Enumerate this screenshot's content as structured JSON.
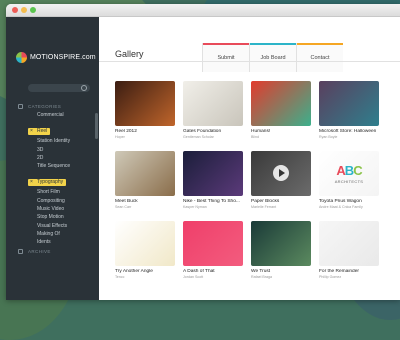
{
  "brand": {
    "name": "MOTIONSPIRE.com"
  },
  "sidebar": {
    "search_placeholder": "",
    "categories_title": "CATEGORIES",
    "archive_title": "ARCHIVE",
    "categories": [
      {
        "label": "Commercial",
        "selected": false
      },
      {
        "label": "Reel",
        "selected": true
      },
      {
        "label": "Station Identity",
        "selected": false
      },
      {
        "label": "3D",
        "selected": false
      },
      {
        "label": "2D",
        "selected": false
      },
      {
        "label": "Title Sequence",
        "selected": false
      },
      {
        "label": "Typography",
        "selected": true
      },
      {
        "label": "Short Film",
        "selected": false
      },
      {
        "label": "Compositing",
        "selected": false
      },
      {
        "label": "Music Video",
        "selected": false
      },
      {
        "label": "Stop Motion",
        "selected": false
      },
      {
        "label": "Visual Effects",
        "selected": false
      },
      {
        "label": "Making Of",
        "selected": false
      },
      {
        "label": "Idents",
        "selected": false
      }
    ]
  },
  "header": {
    "title": "Gallery",
    "nav": [
      {
        "label": "Submit",
        "accent": "#e84b5a"
      },
      {
        "label": "Job Board",
        "accent": "#2cb4c8"
      },
      {
        "label": "Contact",
        "accent": "#f5a623"
      }
    ]
  },
  "gallery": [
    {
      "title": "Reel 2012",
      "author": "Hoper",
      "colors": [
        "#3b1d12",
        "#c0652b"
      ]
    },
    {
      "title": "Gates Foundation",
      "author": "Gentleman Scholar",
      "colors": [
        "#f1efe9",
        "#c9c5bb"
      ]
    },
    {
      "title": "Humans!",
      "author": "Blind",
      "colors": [
        "#e23b2d",
        "#3cb08c"
      ]
    },
    {
      "title": "Microsoft Store: Halloween",
      "author": "Ryan Boyle",
      "colors": [
        "#5a3f5e",
        "#2f7f8d"
      ]
    },
    {
      "title": "Meet Buck",
      "author": "Sean Carr",
      "colors": [
        "#cfc9b8",
        "#8a6d4a"
      ]
    },
    {
      "title": "Nike - Best Thing To Sho...",
      "author": "Kasper Nyman",
      "colors": [
        "#1b1e3a",
        "#5b3a7a"
      ]
    },
    {
      "title": "Paper Blocks",
      "author": "Marielle Ferrant",
      "colors": [
        "#3a3a3a",
        "#6b6b6b"
      ],
      "play": true
    },
    {
      "title": "Toyota Prius Wagon",
      "author": "Andre Maat & Cnlca Family",
      "colors": [
        "#ffffff",
        "#f4f4f4"
      ],
      "abc": "ABC",
      "abc_sub": "ARCHITECTS"
    },
    {
      "title": "Try Another Angle",
      "author": "Tencc",
      "colors": [
        "#ffffff",
        "#f1e8c8"
      ]
    },
    {
      "title": "A Dash of That",
      "author": "Jordan Scott",
      "colors": [
        "#ef3f6a",
        "#f35c7e"
      ]
    },
    {
      "title": "We Trust",
      "author": "Rafael Braga",
      "colors": [
        "#1a3a38",
        "#5b8a5f"
      ]
    },
    {
      "title": "For the Remainder",
      "author": "Phillip Gomez",
      "colors": [
        "#f6f6f6",
        "#e9e9e9"
      ]
    }
  ]
}
